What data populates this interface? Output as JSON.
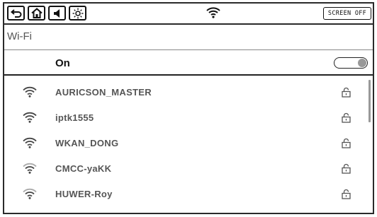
{
  "topbar": {
    "icons": [
      "back-icon",
      "home-icon",
      "volume-icon",
      "brightness-icon"
    ],
    "status_icon": "wifi-icon",
    "screen_off_label": "SCREEN OFF"
  },
  "page": {
    "title": "Wi-Fi"
  },
  "wifi_toggle": {
    "label": "On",
    "state": "on"
  },
  "networks": [
    {
      "ssid": "AURICSON_MASTER",
      "locked": true,
      "signal": "full"
    },
    {
      "ssid": "iptk1555",
      "locked": true,
      "signal": "full"
    },
    {
      "ssid": "WKAN_DONG",
      "locked": true,
      "signal": "full"
    },
    {
      "ssid": "CMCC-yaKK",
      "locked": true,
      "signal": "medium"
    },
    {
      "ssid": "HUWER-Roy",
      "locked": true,
      "signal": "medium"
    }
  ]
}
